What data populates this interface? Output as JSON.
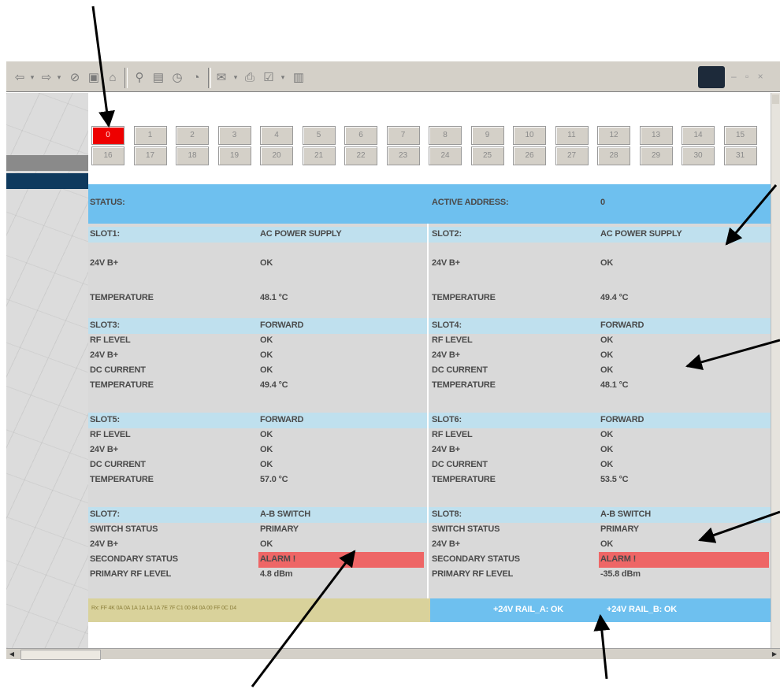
{
  "addresses": {
    "row1": [
      "0",
      "1",
      "2",
      "3",
      "4",
      "5",
      "6",
      "7",
      "8",
      "9",
      "10",
      "11",
      "12",
      "13",
      "14",
      "15"
    ],
    "row2": [
      "16",
      "17",
      "18",
      "19",
      "20",
      "21",
      "22",
      "23",
      "24",
      "25",
      "26",
      "27",
      "28",
      "29",
      "30",
      "31"
    ],
    "active": "0"
  },
  "status": {
    "label": "STATUS:",
    "active_address_label": "ACTIVE ADDRESS:",
    "active_address_value": "0"
  },
  "slots": [
    {
      "name": "SLOT1:",
      "type": "AC POWER SUPPLY",
      "rows": [
        [
          "24V B+",
          "OK"
        ],
        [
          "TEMPERATURE",
          "48.1 °C"
        ]
      ]
    },
    {
      "name": "SLOT2:",
      "type": "AC POWER SUPPLY",
      "rows": [
        [
          "24V B+",
          "OK"
        ],
        [
          "TEMPERATURE",
          "49.4 °C"
        ]
      ]
    },
    {
      "name": "SLOT3:",
      "type": "FORWARD",
      "rows": [
        [
          "RF LEVEL",
          "OK"
        ],
        [
          "24V B+",
          "OK"
        ],
        [
          "DC CURRENT",
          "OK"
        ],
        [
          "TEMPERATURE",
          "49.4 °C"
        ]
      ]
    },
    {
      "name": "SLOT4:",
      "type": "FORWARD",
      "rows": [
        [
          "RF LEVEL",
          "OK"
        ],
        [
          "24V B+",
          "OK"
        ],
        [
          "DC CURRENT",
          "OK"
        ],
        [
          "TEMPERATURE",
          "48.1 °C"
        ]
      ]
    },
    {
      "name": "SLOT5:",
      "type": "FORWARD",
      "rows": [
        [
          "RF LEVEL",
          "OK"
        ],
        [
          "24V B+",
          "OK"
        ],
        [
          "DC CURRENT",
          "OK"
        ],
        [
          "TEMPERATURE",
          "57.0 °C"
        ]
      ]
    },
    {
      "name": "SLOT6:",
      "type": "FORWARD",
      "rows": [
        [
          "RF LEVEL",
          "OK"
        ],
        [
          "24V B+",
          "OK"
        ],
        [
          "DC CURRENT",
          "OK"
        ],
        [
          "TEMPERATURE",
          "53.5 °C"
        ]
      ]
    },
    {
      "name": "SLOT7:",
      "type": "A-B SWITCH",
      "rows": [
        [
          "SWITCH STATUS",
          "PRIMARY"
        ],
        [
          "24V B+",
          "OK"
        ],
        [
          "SECONDARY STATUS",
          "ALARM !"
        ],
        [
          "PRIMARY RF LEVEL",
          "4.8 dBm"
        ]
      ]
    },
    {
      "name": "SLOT8:",
      "type": "A-B SWITCH",
      "rows": [
        [
          "SWITCH STATUS",
          "PRIMARY"
        ],
        [
          "24V B+",
          "OK"
        ],
        [
          "SECONDARY STATUS",
          "ALARM !"
        ],
        [
          "PRIMARY RF LEVEL",
          "-35.8 dBm"
        ]
      ]
    }
  ],
  "footer": {
    "rx_text": "Rx: FF 4K 0A 0A 1A 1A 1A 1A 7E 7F C1 00 84 0A 00 FF 0C D4",
    "rail_a": "+24V RAIL_A: OK",
    "rail_b": "+24V RAIL_B: OK"
  },
  "colors": {
    "status_bar": "#6ec0ef",
    "slot_header": "#bfe0ee",
    "slot_body": "#d9d9d9",
    "alarm": "#ee6666",
    "active_address": "#ee0000",
    "rx_bar": "#d9d29b",
    "annotation_arrow": "#000000"
  },
  "toolbar": {
    "icons": [
      "back-icon",
      "forward-icon",
      "stop-icon",
      "refresh-icon",
      "home-icon",
      "search-icon",
      "favorites-icon",
      "history-icon",
      "mail-icon",
      "print-icon",
      "edit-icon",
      "discuss-icon"
    ]
  }
}
